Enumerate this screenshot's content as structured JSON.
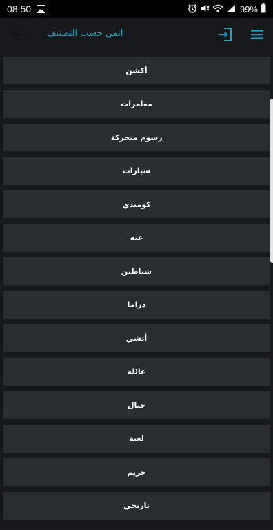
{
  "status_bar": {
    "time": "08:50",
    "battery": "99%",
    "icons": [
      "image-icon",
      "alarm-icon",
      "mute-icon",
      "wifi-icon",
      "signal-icon",
      "battery-icon"
    ]
  },
  "app_bar": {
    "title": "انمي حسب التصنيف",
    "back_icon": "arrow-left-icon",
    "login_icon": "login-icon",
    "menu_icon": "hamburger-menu-icon"
  },
  "genres": [
    "أكشن",
    "مغامرات",
    "رسوم متحركة",
    "سيارات",
    "كوميدي",
    "عته",
    "شياطين",
    "دراما",
    "أتشي",
    "عائلة",
    "خيال",
    "لعبة",
    "حريم",
    "تاريخي"
  ],
  "colors": {
    "background": "#17191c",
    "item": "#2a2d32",
    "accent": "#1aa3c4"
  }
}
